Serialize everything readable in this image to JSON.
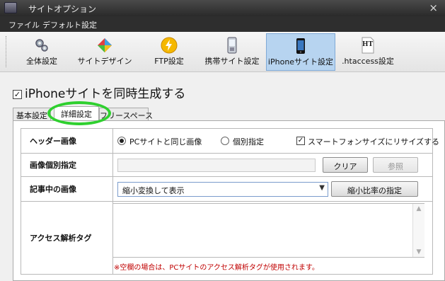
{
  "window": {
    "title": "サイトオプション",
    "close_glyph": "×"
  },
  "menu": {
    "items": [
      "ファイル",
      "デフォルト設定"
    ]
  },
  "toolbar": {
    "buttons": [
      {
        "label": "全体設定",
        "icon": "gears-icon"
      },
      {
        "label": "サイトデザイン",
        "icon": "palette-icon"
      },
      {
        "label": "FTP設定",
        "icon": "lightning-icon"
      },
      {
        "label": "携帯サイト設定",
        "icon": "mobile-phone-icon"
      },
      {
        "label": "iPhoneサイト設定",
        "icon": "iphone-icon"
      },
      {
        "label": ".htaccess設定",
        "icon": "ht-document-icon"
      }
    ],
    "active_index": 4,
    "ht_icon_text": "HT"
  },
  "page": {
    "checkbox_checked": true,
    "check_glyph": "✓",
    "title": "iPhoneサイトを同時生成する"
  },
  "tabs": [
    {
      "label": "基本設定"
    },
    {
      "label": "詳細設定"
    },
    {
      "label": "フリースペース"
    }
  ],
  "selected_tab": 1,
  "form": {
    "header_image": {
      "label": "ヘッダー画像",
      "option_same": "PCサイトと同じ画像",
      "option_individual": "個別指定",
      "selected_option": "option_same",
      "resize_label": "スマートフォンサイズにリサイズする",
      "resize_checked": true
    },
    "image_specify": {
      "label": "画像個別指定",
      "value": "",
      "clear_button": "クリア",
      "browse_button": "参照"
    },
    "article_image": {
      "label": "記事中の画像",
      "selected": "縮小変換して表示",
      "ratio_button": "縮小比率の指定"
    },
    "access_tag": {
      "label": "アクセス解析タグ",
      "value": "",
      "note": "※空欄の場合は、PCサイトのアクセス解析タグが使用されます。"
    }
  },
  "colors": {
    "highlight": "#2fd02f",
    "note": "#c00000",
    "active_toolbar": "#b7d4f0"
  }
}
